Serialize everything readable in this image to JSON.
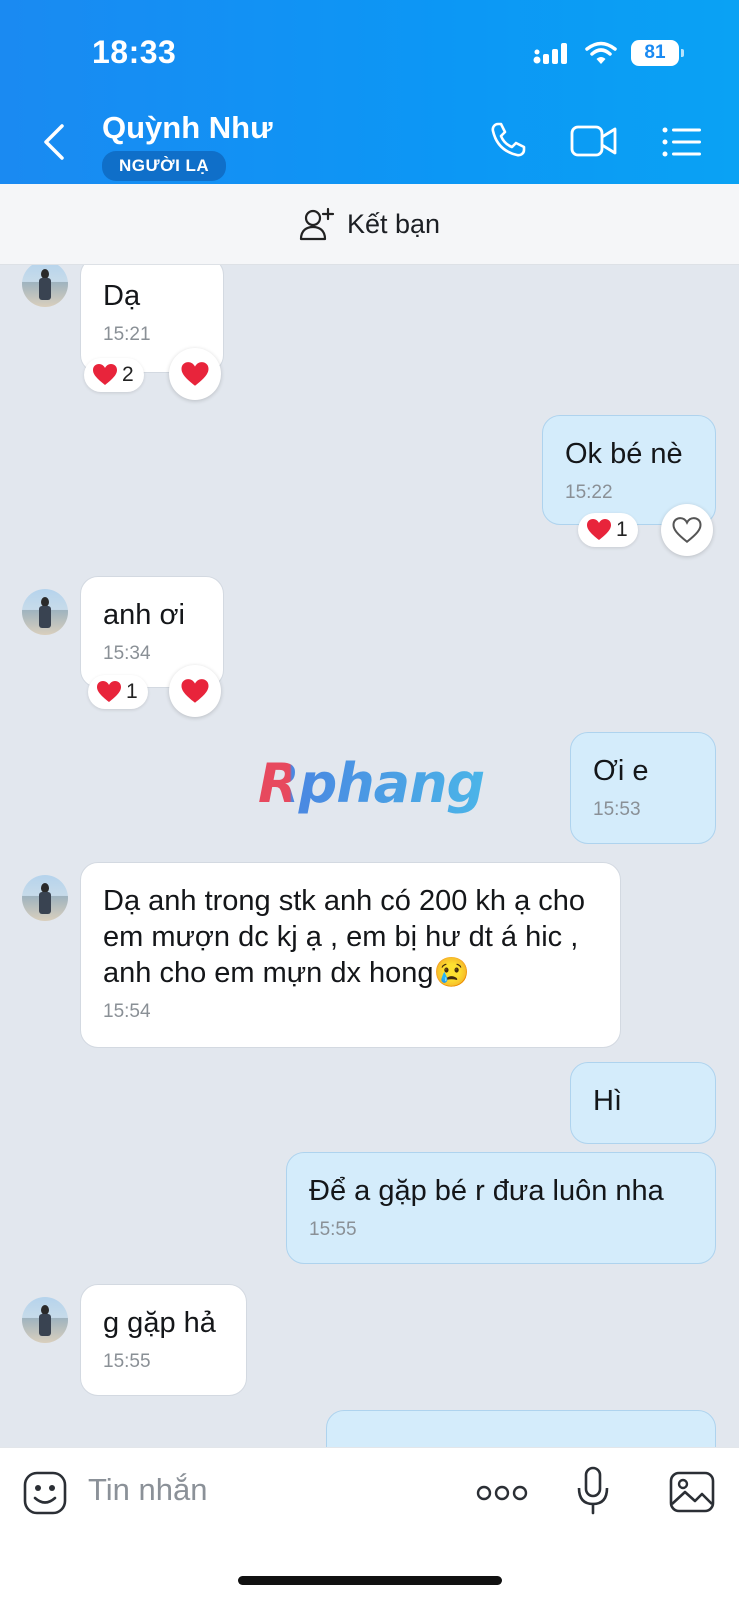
{
  "status_bar": {
    "time": "18:33",
    "battery": "81"
  },
  "header": {
    "contact_name": "Quỳnh Như",
    "badge": "NGƯỜI LẠ"
  },
  "friend_bar": {
    "label": "Kết bạn"
  },
  "messages": [
    {
      "text": "Dạ",
      "time": "15:21",
      "reaction_count": "2"
    },
    {
      "text": "Ok bé nè",
      "time": "15:22",
      "reaction_count": "1"
    },
    {
      "text": "anh ơi",
      "time": "15:34",
      "reaction_count": "1"
    },
    {
      "text": "Ơi e",
      "time": "15:53"
    },
    {
      "text": "Dạ anh trong stk anh có 200 kh ạ cho em mượn dc kj ạ , em bị hư dt á hic , anh cho em mựn dx hong",
      "emoji": "😢",
      "time": "15:54"
    },
    {
      "text": "Hì"
    },
    {
      "text": "Để a gặp bé r đưa luôn nha",
      "time": "15:55"
    },
    {
      "text": "g gặp hả",
      "time": "15:55"
    }
  ],
  "watermark": "Rphang",
  "composer": {
    "placeholder": "Tin nhắn"
  },
  "colors": {
    "header": "#1a8af2",
    "outgoing_bubble": "#d4ecfb",
    "incoming_bubble": "#ffffff",
    "chat_bg": "#e2e7ee",
    "heart": "#e8243b"
  },
  "icons": [
    "back-arrow-icon",
    "phone-icon",
    "video-call-icon",
    "menu-list-icon",
    "add-friend-icon",
    "heart-icon",
    "sticker-icon",
    "more-icon",
    "microphone-icon",
    "image-icon"
  ]
}
